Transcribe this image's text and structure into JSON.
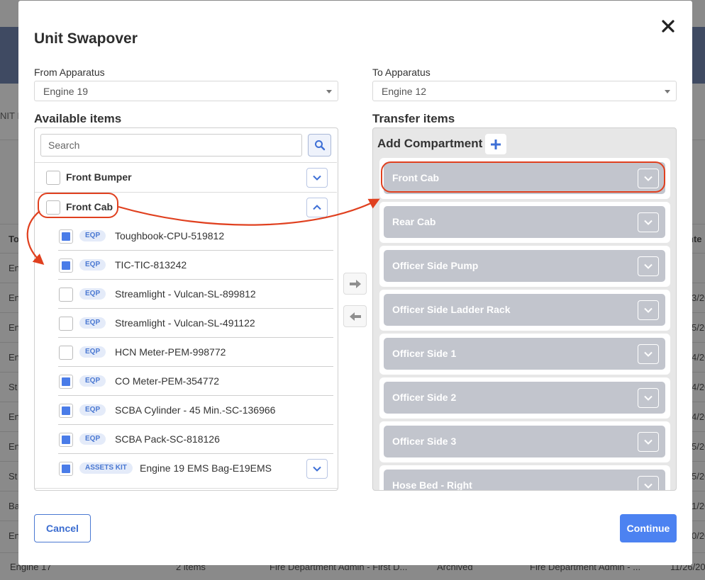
{
  "background": {
    "side_label": "NIT I",
    "column_head_left": "To",
    "column_head_right": "nte",
    "rows": [
      {
        "left": "En",
        "right": ""
      },
      {
        "left": "En",
        "right": "3/20"
      },
      {
        "left": "En",
        "right": "5/20"
      },
      {
        "left": "En",
        "right": "4/20"
      },
      {
        "left": "St",
        "right": "4/20"
      },
      {
        "left": "En",
        "right": "4/20"
      },
      {
        "left": "En",
        "right": "5/20"
      },
      {
        "left": "St",
        "right": "5/20"
      },
      {
        "left": "Ba",
        "right": "1/20"
      },
      {
        "left": "En",
        "right": "0/20"
      }
    ],
    "last_row": {
      "unit": "Engine 17",
      "items": "2 items",
      "created_by": "Fire Department Admin - First D...",
      "status": "Archived",
      "updated_by": "Fire Department Admin - ...",
      "date": "11/26/20"
    }
  },
  "modal": {
    "title": "Unit Swapover",
    "from": {
      "label": "From Apparatus",
      "value": "Engine 19"
    },
    "to": {
      "label": "To Apparatus",
      "value": "Engine 12"
    },
    "available_title": "Available items",
    "transfer_title": "Transfer items",
    "search": {
      "placeholder": "Search",
      "value": ""
    },
    "groups": [
      {
        "label": "Front Bumper",
        "checked": false,
        "expanded": false
      },
      {
        "label": "Front Cab",
        "checked": false,
        "expanded": true
      }
    ],
    "items": [
      {
        "badge": "EQP",
        "label": "Toughbook-CPU-519812",
        "checked": true
      },
      {
        "badge": "EQP",
        "label": "TIC-TIC-813242",
        "checked": true
      },
      {
        "badge": "EQP",
        "label": "Streamlight - Vulcan-SL-899812",
        "checked": false
      },
      {
        "badge": "EQP",
        "label": "Streamlight - Vulcan-SL-491122",
        "checked": false
      },
      {
        "badge": "EQP",
        "label": "HCN Meter-PEM-998772",
        "checked": false
      },
      {
        "badge": "EQP",
        "label": "CO Meter-PEM-354772",
        "checked": true
      },
      {
        "badge": "EQP",
        "label": "SCBA Cylinder - 45 Min.-SC-136966",
        "checked": true
      },
      {
        "badge": "EQP",
        "label": "SCBA Pack-SC-818126",
        "checked": true
      },
      {
        "badge": "ASSETS KIT",
        "label": "Engine 19 EMS Bag-E19EMS",
        "checked": true
      }
    ],
    "add_compartment_label": "Add Compartment",
    "compartments": [
      "Front Cab",
      "Rear Cab",
      "Officer Side Pump",
      "Officer Side Ladder Rack",
      "Officer Side 1",
      "Officer Side 2",
      "Officer Side 3",
      "Hose Bed - Right"
    ],
    "cancel_label": "Cancel",
    "continue_label": "Continue"
  },
  "colors": {
    "accent": "#4c82f1",
    "annotation": "#e0401f",
    "compartment_bar": "#c2c5cd"
  },
  "icons": {
    "close": "close-icon",
    "search": "search-icon",
    "expand": "chevron-down-icon",
    "collapse": "chevron-up-icon",
    "transfer_right": "arrow-right-icon",
    "transfer_left": "arrow-left-icon",
    "add": "plus-icon"
  }
}
